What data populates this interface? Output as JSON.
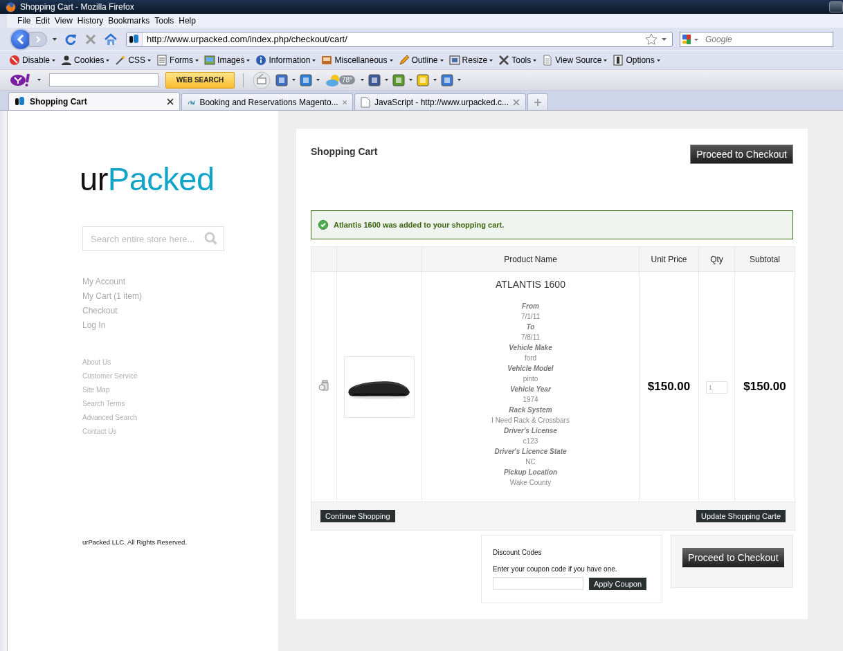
{
  "window": {
    "title": "Shopping Cart - Mozilla Firefox"
  },
  "menu": [
    "File",
    "Edit",
    "View",
    "History",
    "Bookmarks",
    "Tools",
    "Help"
  ],
  "navigation": {
    "url": "http://www.urpacked.com/index.php/checkout/cart/",
    "search_placeholder": "Google"
  },
  "developer_toolbar": [
    "Disable",
    "Cookies",
    "CSS",
    "Forms",
    "Images",
    "Information",
    "Miscellaneous",
    "Outline",
    "Resize",
    "Tools",
    "View Source",
    "Options"
  ],
  "yahoo_toolbar": {
    "search_button": "WEB SEARCH",
    "weather": "78°"
  },
  "tabs": [
    {
      "title": "Shopping Cart",
      "selected": true
    },
    {
      "title": "Booking and Reservations Magento...",
      "selected": false
    },
    {
      "title": "JavaScript - http://www.urpacked.c...",
      "selected": false
    }
  ],
  "sidebar": {
    "logo_dark": "ur",
    "logo_accent": "Packed",
    "search_placeholder": "Search entire store here...",
    "account_links": [
      "My Account",
      "My Cart (1 item)",
      "Checkout",
      "Log In"
    ],
    "footer_links": [
      "About Us",
      "Customer Service",
      "Site Map",
      "Search Terms",
      "Advanced Search",
      "Contact Us"
    ],
    "copyright": "urPacked LLC. All Rights Reserved."
  },
  "cart": {
    "title": "Shopping Cart",
    "checkout_button": "Proceed to Checkout",
    "message": "Atlantis 1600 was added to your shopping cart.",
    "columns": [
      "Product Name",
      "Unit Price",
      "Qty",
      "Subtotal"
    ],
    "items": [
      {
        "name": "ATLANTIS 1600",
        "options": [
          {
            "label": "From",
            "value": "7/1/11"
          },
          {
            "label": "To",
            "value": "7/8/11"
          },
          {
            "label": "Vehicle Make",
            "value": "ford"
          },
          {
            "label": "Vehicle Model",
            "value": "pinto"
          },
          {
            "label": "Vehicle Year",
            "value": "1974"
          },
          {
            "label": "Rack System",
            "value": "I Need Rack & Crossbars"
          },
          {
            "label": "Driver's License",
            "value": "c123"
          },
          {
            "label": "Driver's Licence State",
            "value": "NC"
          },
          {
            "label": "Pickup Location",
            "value": "Wake County"
          }
        ],
        "unit_price": "$150.00",
        "qty": "1",
        "subtotal": "$150.00"
      }
    ],
    "continue_button": "Continue Shopping",
    "update_button": "Update Shopping Carte",
    "discount": {
      "title": "Discount Codes",
      "hint": "Enter your coupon code if you have one.",
      "apply_button": "Apply Coupon"
    },
    "checkout_button_bottom": "Proceed to Checkout"
  }
}
